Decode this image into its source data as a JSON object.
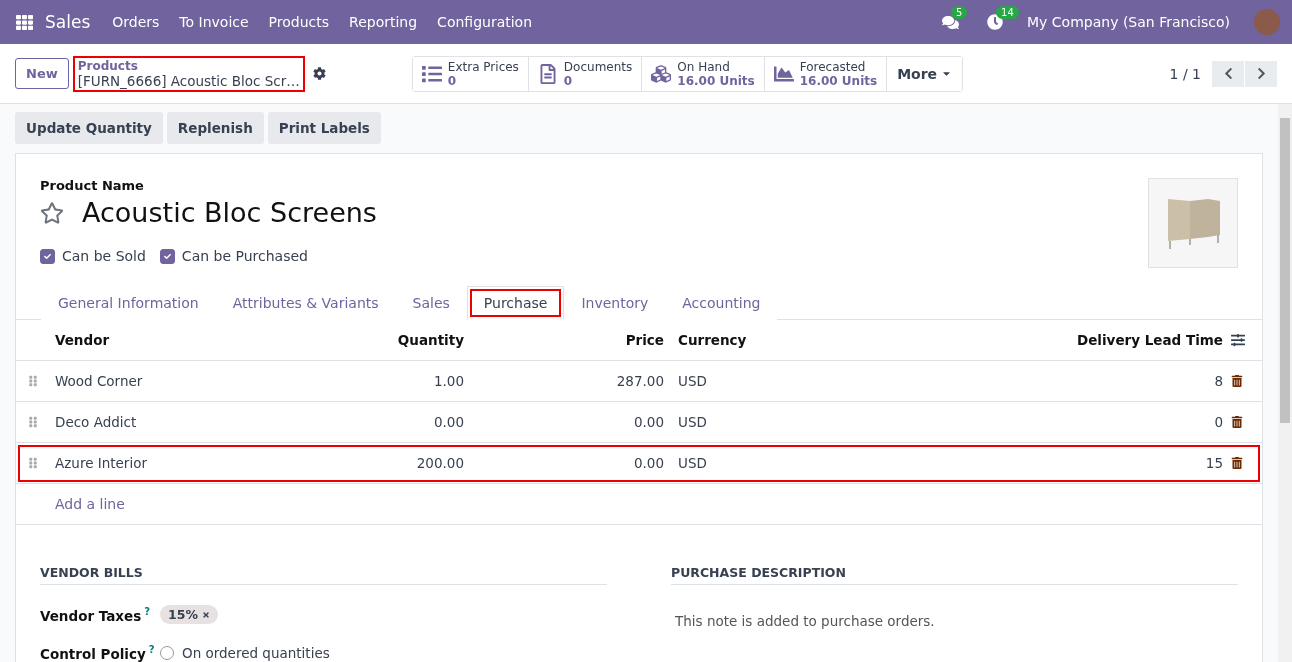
{
  "navbar": {
    "app": "Sales",
    "menu": [
      "Orders",
      "To Invoice",
      "Products",
      "Reporting",
      "Configuration"
    ],
    "messages_badge": "5",
    "activities_badge": "14",
    "company": "My Company (San Francisco)"
  },
  "control_panel": {
    "new_button": "New",
    "breadcrumb": "Products",
    "record": "[FURN_6666] Acoustic Bloc Scr…",
    "record_highlighted": true,
    "smart_buttons": [
      {
        "kind": "list",
        "label": "Extra Prices",
        "value": "0"
      },
      {
        "kind": "document",
        "label": "Documents",
        "value": "0"
      },
      {
        "kind": "cubes",
        "label": "On Hand",
        "value": "16.00 Units"
      },
      {
        "kind": "chart",
        "label": "Forecasted",
        "value": "16.00 Units"
      }
    ],
    "more": "More",
    "pager": "1 / 1"
  },
  "actions": [
    "Update Quantity",
    "Replenish",
    "Print Labels"
  ],
  "form": {
    "name_label": "Product Name",
    "name": "Acoustic Bloc Screens",
    "favorite": false,
    "checkboxes": [
      {
        "label": "Can be Sold",
        "checked": true
      },
      {
        "label": "Can be Purchased",
        "checked": true
      }
    ],
    "tabs": [
      {
        "label": "General Information",
        "selected": false,
        "highlighted": false
      },
      {
        "label": "Attributes & Variants",
        "selected": false,
        "highlighted": false
      },
      {
        "label": "Sales",
        "selected": false,
        "highlighted": false
      },
      {
        "label": "Purchase",
        "selected": true,
        "highlighted": true
      },
      {
        "label": "Inventory",
        "selected": false,
        "highlighted": false
      },
      {
        "label": "Accounting",
        "selected": false,
        "highlighted": false
      }
    ]
  },
  "vendor_table": {
    "columns": [
      "Vendor",
      "Quantity",
      "Price",
      "Currency",
      "Delivery Lead Time"
    ],
    "rows": [
      {
        "vendor": "Wood Corner",
        "quantity": "1.00",
        "price": "287.00",
        "currency": "USD",
        "lead_time": "8",
        "highlighted": false
      },
      {
        "vendor": "Deco Addict",
        "quantity": "0.00",
        "price": "0.00",
        "currency": "USD",
        "lead_time": "0",
        "highlighted": false
      },
      {
        "vendor": "Azure Interior",
        "quantity": "200.00",
        "price": "0.00",
        "currency": "USD",
        "lead_time": "15",
        "highlighted": true
      }
    ],
    "add_line": "Add a line"
  },
  "vendor_bills": {
    "title": "VENDOR BILLS",
    "fields": [
      {
        "kind": "tags",
        "label": "Vendor Taxes",
        "help": "?",
        "tags": [
          "15%"
        ]
      },
      {
        "kind": "radio",
        "label": "Control Policy",
        "help": "?",
        "options": [
          {
            "label": "On ordered quantities",
            "selected": false
          }
        ]
      }
    ]
  },
  "purchase_description": {
    "title": "PURCHASE DESCRIPTION",
    "placeholder": "This note is added to purchase orders."
  }
}
